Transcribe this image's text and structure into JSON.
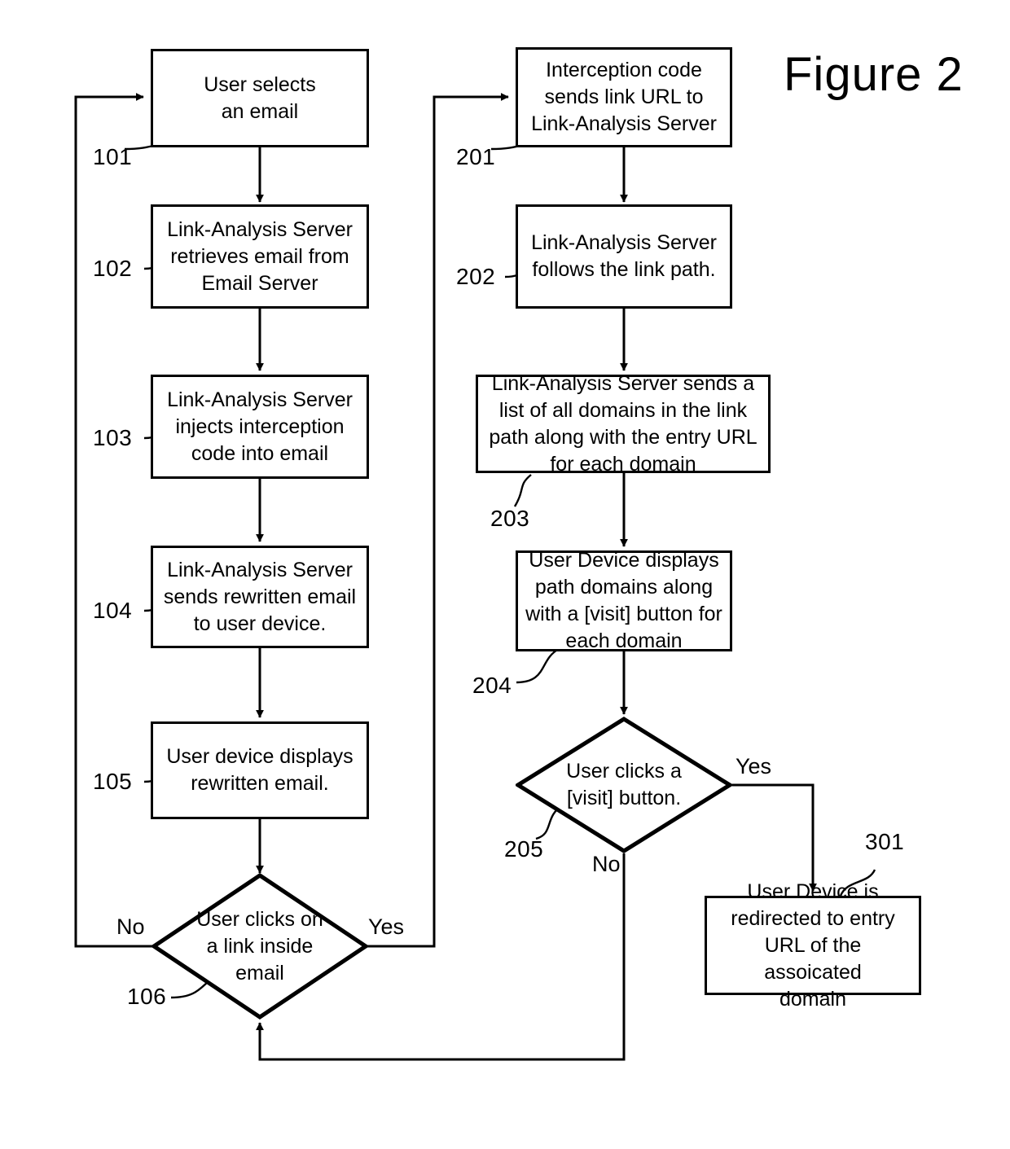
{
  "figure": {
    "title": "Figure 2"
  },
  "nodes": [
    {
      "ref": "101",
      "shape": "process",
      "text": "User selects\nan email"
    },
    {
      "ref": "102",
      "shape": "process",
      "text": "Link-Analysis Server\nretrieves email from\nEmail Server"
    },
    {
      "ref": "103",
      "shape": "process",
      "text": "Link-Analysis Server\ninjects interception\ncode into email"
    },
    {
      "ref": "104",
      "shape": "process",
      "text": "Link-Analysis Server\nsends rewritten email\nto user device."
    },
    {
      "ref": "105",
      "shape": "process",
      "text": "User device displays\nrewritten email."
    },
    {
      "ref": "106",
      "shape": "decision",
      "text": "User clicks on\na link inside\nemail"
    },
    {
      "ref": "201",
      "shape": "process",
      "text": "Interception code\nsends link URL to\nLink-Analysis Server"
    },
    {
      "ref": "202",
      "shape": "process",
      "text": "Link-Analysis Server\nfollows the link path."
    },
    {
      "ref": "203",
      "shape": "process",
      "text": "Link-Analysis Server sends a\nlist of all domains in the link\npath along with the entry URL\nfor each domain"
    },
    {
      "ref": "204",
      "shape": "process",
      "text": "User Device displays\npath domains along\nwith a [visit] button for\neach domain"
    },
    {
      "ref": "205",
      "shape": "decision",
      "text": "User clicks a\n[visit] button."
    },
    {
      "ref": "301",
      "shape": "process",
      "text": "User Device is\nredirected to entry\nURL of the assoicated\ndomain"
    }
  ],
  "branch_labels": {
    "d106_no": "No",
    "d106_yes": "Yes",
    "d205_no": "No",
    "d205_yes": "Yes"
  },
  "colors": {
    "stroke": "#000000",
    "background": "#ffffff"
  }
}
